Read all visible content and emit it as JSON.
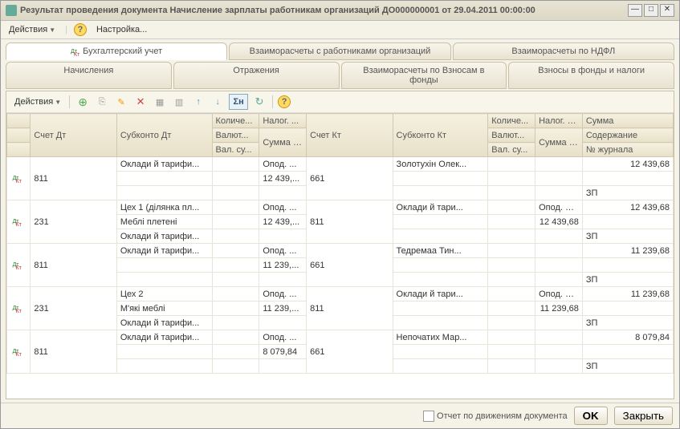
{
  "window": {
    "title": "Результат проведения документа Начисление зарплаты работникам организаций ДО000000001 от 29.04.2011 00:00:00"
  },
  "menubar": {
    "actions": "Действия",
    "settings": "Настройка..."
  },
  "tabs_row1": [
    "Бухгалтерский учет",
    "Взаиморасчеты с работниками организаций",
    "Взаиморасчеты по НДФЛ"
  ],
  "tabs_row2": [
    "Начисления",
    "Отражения",
    "Взаиморасчеты по Взносам в фонды",
    "Взносы в фонды и налоги"
  ],
  "toolbar": {
    "actions": "Действия"
  },
  "headers": {
    "r1": [
      "",
      "Счет Дт",
      "Субконто Дт",
      "Количе...",
      "Налог. ...",
      "Счет Кт",
      "Субконто Кт",
      "Количе...",
      "Налог. назн...",
      "Сумма"
    ],
    "r2": [
      "",
      "",
      "",
      "Валют...",
      "Сумма (н/у) Дт",
      "",
      "",
      "Валют...",
      "Сумма (н/у) Кт",
      "Содержание"
    ],
    "r3": [
      "",
      "",
      "",
      "Вал. су...",
      "",
      "",
      "",
      "Вал. су...",
      "",
      "№ журнала"
    ]
  },
  "rows": [
    {
      "acc_dt": "811",
      "sub_dt1": "Оклади й тарифи...",
      "tax_dt1": "Опод. ...",
      "tax_dt2": "12 439,...",
      "acc_kt": "661",
      "sub_kt1": "Золотухін Олек...",
      "sum1": "12 439,68",
      "content": "ЗП"
    },
    {
      "acc_dt": "231",
      "sub_dt1": "Цех 1 (ділянка пл...",
      "sub_dt2": "Меблі плетені",
      "sub_dt3": "Оклади й тарифи...",
      "tax_dt1": "Опод. ...",
      "tax_dt2": "12 439,...",
      "acc_kt": "811",
      "sub_kt1": "Оклади й тари...",
      "tax_kt1": "Опод. ПДВ",
      "tax_kt2": "12 439,68",
      "sum1": "12 439,68",
      "content": "ЗП"
    },
    {
      "acc_dt": "811",
      "sub_dt1": "Оклади й тарифи...",
      "tax_dt1": "Опод. ...",
      "tax_dt2": "11 239,...",
      "acc_kt": "661",
      "sub_kt1": "Тедремаа Тин...",
      "sum1": "11 239,68",
      "content": "ЗП"
    },
    {
      "acc_dt": "231",
      "sub_dt1": "Цех 2",
      "sub_dt2": "М'які меблі",
      "sub_dt3": "Оклади й тарифи...",
      "tax_dt1": "Опод. ...",
      "tax_dt2": "11 239,...",
      "acc_kt": "811",
      "sub_kt1": "Оклади й тари...",
      "tax_kt1": "Опод. ПДВ",
      "tax_kt2": "11 239,68",
      "sum1": "11 239,68",
      "content": "ЗП"
    },
    {
      "acc_dt": "811",
      "sub_dt1": "Оклади й тарифи...",
      "tax_dt1": "Опод. ...",
      "tax_dt2": "8 079,84",
      "acc_kt": "661",
      "sub_kt1": "Непочатих Мар...",
      "sum1": "8 079,84",
      "content": "ЗП"
    }
  ],
  "footer": {
    "report_link": "Отчет по движениям документа",
    "ok": "OK",
    "close": "Закрыть"
  }
}
